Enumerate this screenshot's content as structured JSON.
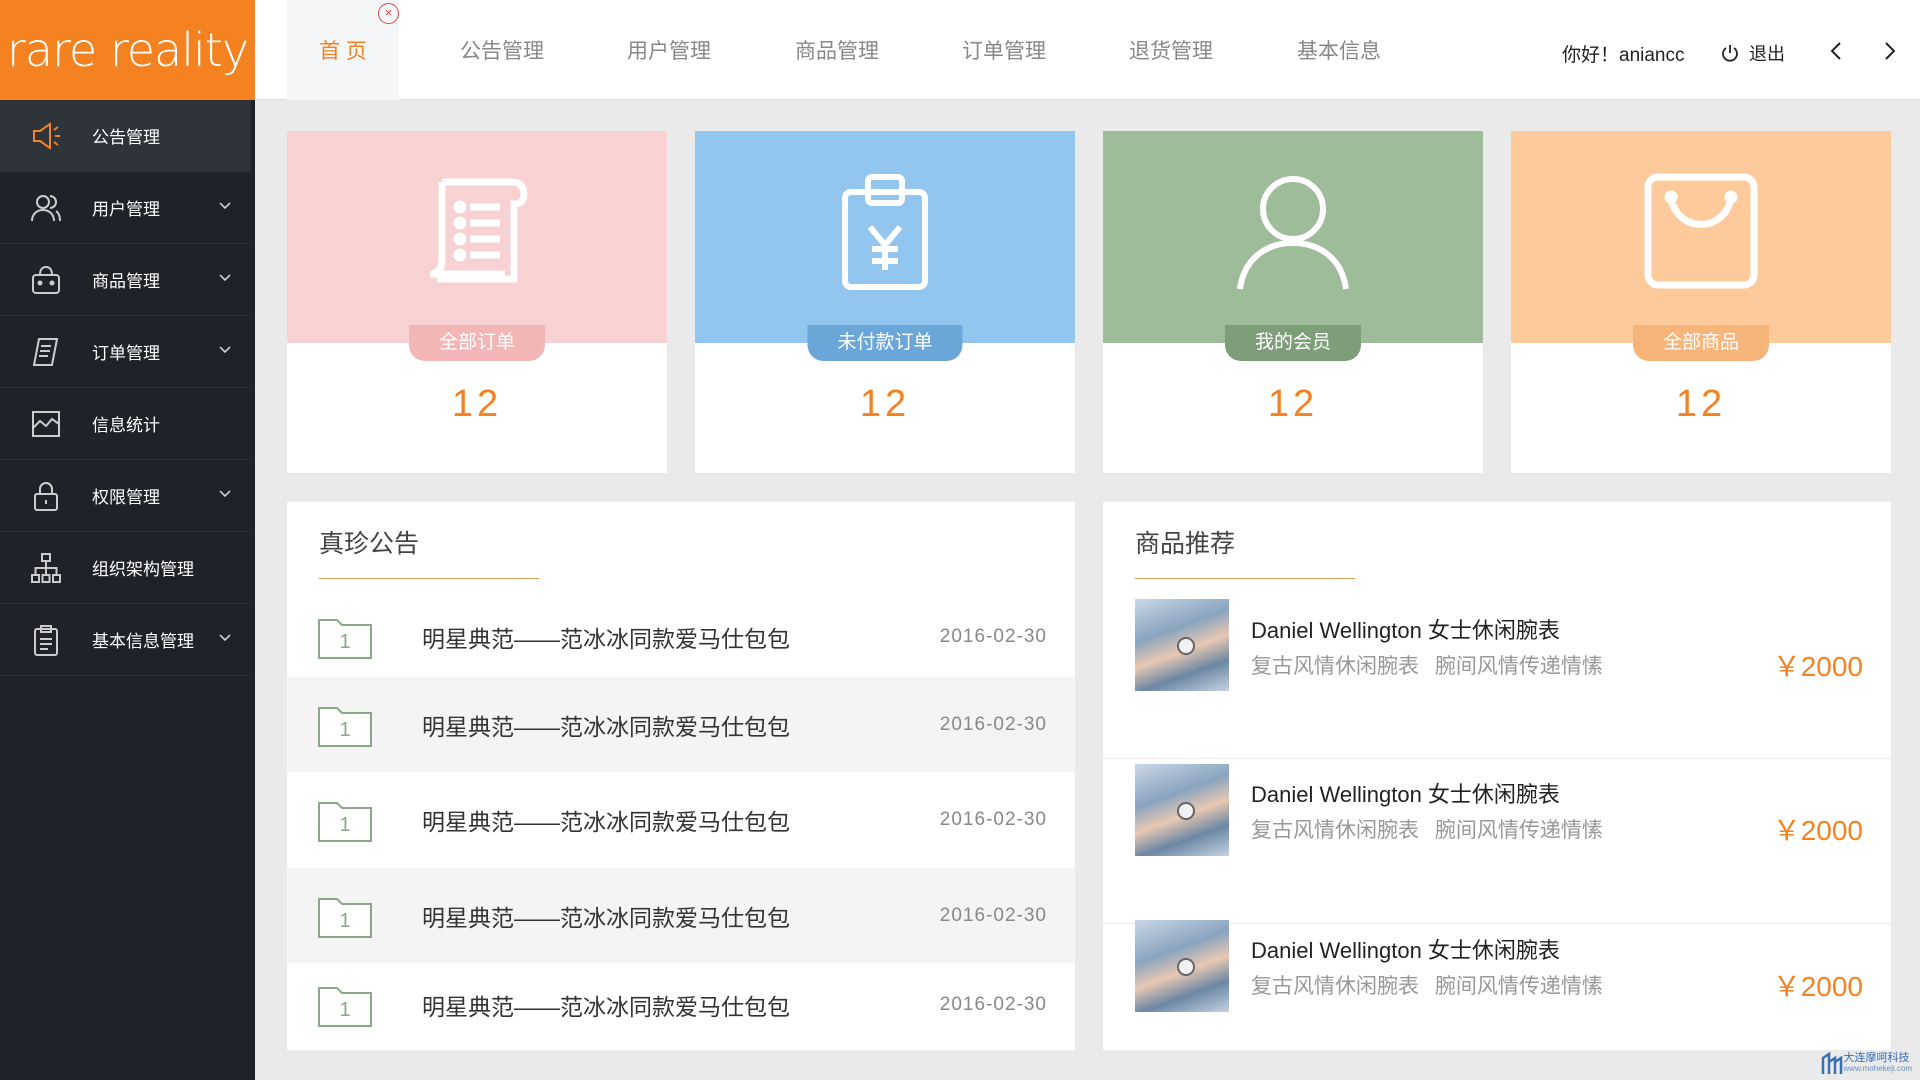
{
  "app": {
    "logo": "rare reality"
  },
  "sidebar": {
    "items": [
      {
        "label": "公告管理",
        "icon": "megaphone-icon",
        "has_chevron": false
      },
      {
        "label": "用户管理",
        "icon": "users-icon",
        "has_chevron": true
      },
      {
        "label": "商品管理",
        "icon": "shopping-basket-icon",
        "has_chevron": true
      },
      {
        "label": "订单管理",
        "icon": "order-list-icon",
        "has_chevron": true
      },
      {
        "label": "信息统计",
        "icon": "chart-icon",
        "has_chevron": false
      },
      {
        "label": "权限管理",
        "icon": "lock-icon",
        "has_chevron": true
      },
      {
        "label": "组织架构管理",
        "icon": "org-chart-icon",
        "has_chevron": false
      },
      {
        "label": "基本信息管理",
        "icon": "clipboard-icon",
        "has_chevron": true
      }
    ]
  },
  "topbar": {
    "tabs": [
      "首 页",
      "公告管理",
      "用户管理",
      "商品管理",
      "订单管理",
      "退货管理",
      "基本信息"
    ],
    "close_glyph": "×",
    "greeting": "你好！aniancc",
    "logout_label": "退出"
  },
  "stats": [
    {
      "label": "全部订单",
      "value": "12",
      "color": "#f8d2d2",
      "label_color": "#f3b6b6",
      "icon": "order-scroll-icon"
    },
    {
      "label": "未付款订单",
      "value": "12",
      "color": "#93c6ee",
      "label_color": "#6ba6d8",
      "icon": "unpaid-clipboard-icon"
    },
    {
      "label": "我的会员",
      "value": "12",
      "color": "#9fbc9a",
      "label_color": "#7d9e79",
      "icon": "member-icon"
    },
    {
      "label": "全部商品",
      "value": "12",
      "color": "#fdcb9b",
      "label_color": "#f7b57a",
      "icon": "bag-icon"
    }
  ],
  "notices": {
    "title": "真珍公告",
    "rows": [
      {
        "num": "1",
        "text": "明星典范——范冰冰同款爱马仕包包",
        "date": "2016-02-30"
      },
      {
        "num": "1",
        "text": "明星典范——范冰冰同款爱马仕包包",
        "date": "2016-02-30"
      },
      {
        "num": "1",
        "text": "明星典范——范冰冰同款爱马仕包包",
        "date": "2016-02-30"
      },
      {
        "num": "1",
        "text": "明星典范——范冰冰同款爱马仕包包",
        "date": "2016-02-30"
      },
      {
        "num": "1",
        "text": "明星典范——范冰冰同款爱马仕包包",
        "date": "2016-02-30"
      }
    ]
  },
  "products": {
    "title": "商品推荐",
    "rows": [
      {
        "name": "Daniel Wellington 女士休闲腕表",
        "desc": "复古风情休闲腕表  腕间风情传递情愫",
        "price": "￥2000"
      },
      {
        "name": "Daniel Wellington 女士休闲腕表",
        "desc": "复古风情休闲腕表  腕间风情传递情愫",
        "price": "￥2000"
      },
      {
        "name": "Daniel Wellington 女士休闲腕表",
        "desc": "复古风情休闲腕表  腕间风情传递情愫",
        "price": "￥2000"
      }
    ]
  },
  "watermark": {
    "text": "大连摩呵科技",
    "sub": "www.mohekeji.com"
  }
}
